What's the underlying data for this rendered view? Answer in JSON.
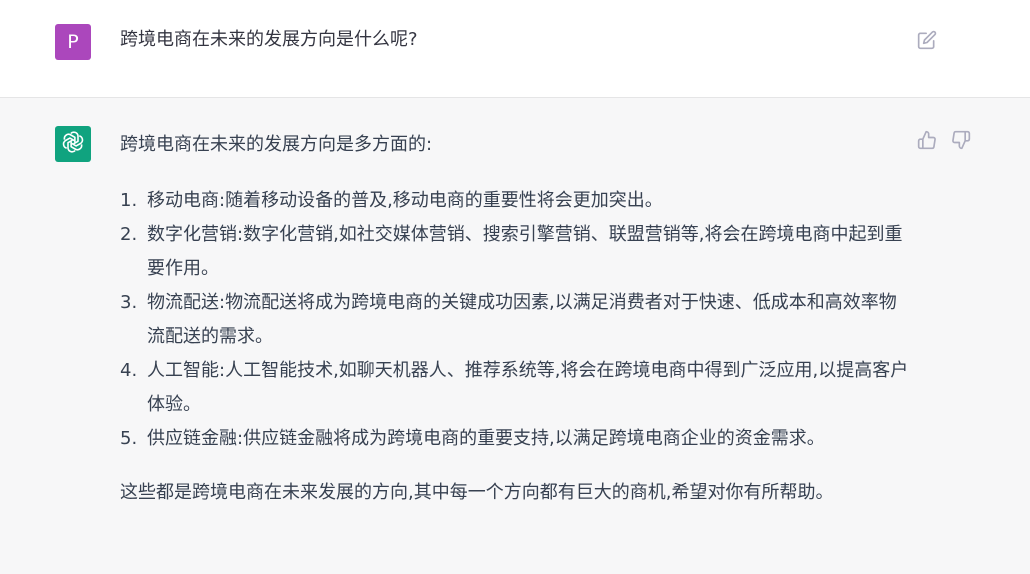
{
  "user": {
    "avatar_letter": "P",
    "avatar_color": "#ab47bc",
    "message": "跨境电商在未来的发展方向是什么呢?"
  },
  "assistant": {
    "avatar_color": "#10a37f",
    "avatar_icon": "openai-logo-icon",
    "intro": "跨境电商在未来的发展方向是多方面的:",
    "items": [
      {
        "num": "1.",
        "text": "移动电商:随着移动设备的普及,移动电商的重要性将会更加突出。"
      },
      {
        "num": "2.",
        "text": "数字化营销:数字化营销,如社交媒体营销、搜索引擎营销、联盟营销等,将会在跨境电商中起到重要作用。"
      },
      {
        "num": "3.",
        "text": "物流配送:物流配送将成为跨境电商的关键成功因素,以满足消费者对于快速、低成本和高效率物流配送的需求。"
      },
      {
        "num": "4.",
        "text": "人工智能:人工智能技术,如聊天机器人、推荐系统等,将会在跨境电商中得到广泛应用,以提高客户体验。"
      },
      {
        "num": "5.",
        "text": "供应链金融:供应链金融将成为跨境电商的重要支持,以满足跨境电商企业的资金需求。"
      }
    ],
    "outro": "这些都是跨境电商在未来发展的方向,其中每一个方向都有巨大的商机,希望对你有所帮助。"
  },
  "icons": {
    "edit": "edit-icon",
    "thumbs_up": "thumbs-up-icon",
    "thumbs_down": "thumbs-down-icon"
  }
}
